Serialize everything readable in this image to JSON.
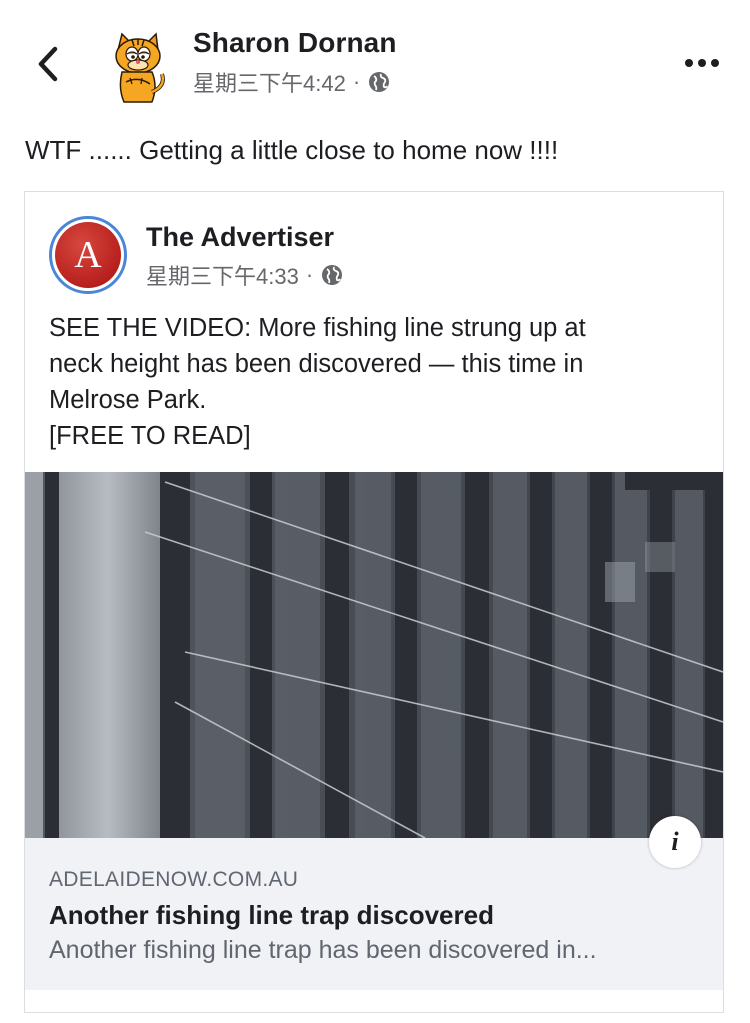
{
  "post": {
    "author": "Sharon Dornan",
    "timestamp": "星期三下午4:42",
    "separator": "·",
    "audience_icon": "globe-icon",
    "caption": "WTF ...... Getting a little close to home now !!!!"
  },
  "header": {
    "back_icon": "chevron-left-icon",
    "more_icon": "more-dots-icon"
  },
  "shared": {
    "page_name": "The Advertiser",
    "page_avatar_letter": "A",
    "timestamp": "星期三下午4:33",
    "separator": "·",
    "audience_icon": "globe-icon",
    "text_lines": [
      "SEE THE VIDEO: More fishing line strung up at",
      "neck height has been discovered — this time in",
      "Melrose Park.",
      "[FREE TO READ]"
    ],
    "info_label": "i"
  },
  "link": {
    "domain": "ADELAIDENOW.COM.AU",
    "title": "Another fishing line trap discovered",
    "description": "Another fishing line trap has been discovered in..."
  },
  "colors": {
    "text": "#1c1e21",
    "secondary": "#65676b",
    "preview_bg": "#f0f2f5",
    "advertiser_red": "#b8201d",
    "avatar_ring": "#4a86d8"
  }
}
